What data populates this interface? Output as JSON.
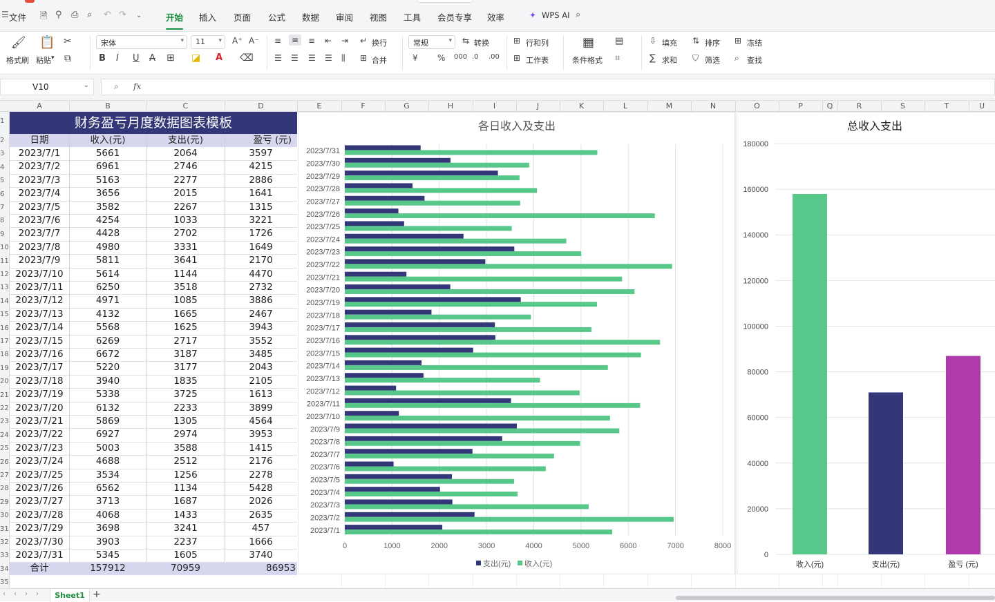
{
  "app": {
    "file_menu": "文件",
    "tabs": [
      "开始",
      "插入",
      "页面",
      "公式",
      "数据",
      "审阅",
      "视图",
      "工具",
      "会员专享",
      "效率"
    ],
    "active_tab": "开始",
    "wps_ai": "WPS AI",
    "accent": "#1e8e3e"
  },
  "ribbon": {
    "format_painter": "格式刷",
    "paste": "粘贴",
    "font_name": "宋体",
    "font_size": "11",
    "wrap": "换行",
    "merge": "合并",
    "number_format": "常规",
    "convert": "转换",
    "rows_cols": "行和列",
    "worksheet": "工作表",
    "conditional_format": "条件格式",
    "fill": "填充",
    "sort": "排序",
    "freeze": "冻结",
    "sum": "求和",
    "filter": "筛选",
    "find": "查找"
  },
  "formula_bar": {
    "name_box": "V10",
    "fx": "fx"
  },
  "columns": [
    "A",
    "B",
    "C",
    "D",
    "E",
    "F",
    "G",
    "H",
    "I",
    "J",
    "K",
    "L",
    "M",
    "N",
    "O",
    "P",
    "Q",
    "R",
    "S",
    "T",
    "U"
  ],
  "row_numbers": [
    "1",
    "2",
    "3",
    "4",
    "5",
    "6",
    "7",
    "8",
    "9",
    "10",
    "11",
    "12",
    "13",
    "14",
    "15",
    "16",
    "17",
    "18",
    "19",
    "20",
    "21",
    "22",
    "23",
    "24",
    "25",
    "26",
    "27",
    "28",
    "29",
    "30",
    "31",
    "32",
    "33",
    "34",
    "35"
  ],
  "table": {
    "title": "财务盈亏月度数据图表模板",
    "headers": [
      "日期",
      "收入(元)",
      "支出(元)",
      "盈亏 (元)"
    ],
    "rows": [
      [
        "2023/7/1",
        "5661",
        "2064",
        "3597"
      ],
      [
        "2023/7/2",
        "6961",
        "2746",
        "4215"
      ],
      [
        "2023/7/3",
        "5163",
        "2277",
        "2886"
      ],
      [
        "2023/7/4",
        "3656",
        "2015",
        "1641"
      ],
      [
        "2023/7/5",
        "3582",
        "2267",
        "1315"
      ],
      [
        "2023/7/6",
        "4254",
        "1033",
        "3221"
      ],
      [
        "2023/7/7",
        "4428",
        "2702",
        "1726"
      ],
      [
        "2023/7/8",
        "4980",
        "3331",
        "1649"
      ],
      [
        "2023/7/9",
        "5811",
        "3641",
        "2170"
      ],
      [
        "2023/7/10",
        "5614",
        "1144",
        "4470"
      ],
      [
        "2023/7/11",
        "6250",
        "3518",
        "2732"
      ],
      [
        "2023/7/12",
        "4971",
        "1085",
        "3886"
      ],
      [
        "2023/7/13",
        "4132",
        "1665",
        "2467"
      ],
      [
        "2023/7/14",
        "5568",
        "1625",
        "3943"
      ],
      [
        "2023/7/15",
        "6269",
        "2717",
        "3552"
      ],
      [
        "2023/7/16",
        "6672",
        "3187",
        "3485"
      ],
      [
        "2023/7/17",
        "5220",
        "3177",
        "2043"
      ],
      [
        "2023/7/18",
        "3940",
        "1835",
        "2105"
      ],
      [
        "2023/7/19",
        "5338",
        "3725",
        "1613"
      ],
      [
        "2023/7/20",
        "6132",
        "2233",
        "3899"
      ],
      [
        "2023/7/21",
        "5869",
        "1305",
        "4564"
      ],
      [
        "2023/7/22",
        "6927",
        "2974",
        "3953"
      ],
      [
        "2023/7/23",
        "5003",
        "3588",
        "1415"
      ],
      [
        "2023/7/24",
        "4688",
        "2512",
        "2176"
      ],
      [
        "2023/7/25",
        "3534",
        "1256",
        "2278"
      ],
      [
        "2023/7/26",
        "6562",
        "1134",
        "5428"
      ],
      [
        "2023/7/27",
        "3713",
        "1687",
        "2026"
      ],
      [
        "2023/7/28",
        "4068",
        "1433",
        "2635"
      ],
      [
        "2023/7/29",
        "3698",
        "3241",
        "457"
      ],
      [
        "2023/7/30",
        "3903",
        "2237",
        "1666"
      ],
      [
        "2023/7/31",
        "5345",
        "1605",
        "3740"
      ]
    ],
    "total": [
      "合计",
      "157912",
      "70959",
      "86953"
    ],
    "header_bg": "#333778",
    "band_bg": "#d6d7ef"
  },
  "chart_data": [
    {
      "type": "bar",
      "orientation": "horizontal",
      "title": "各日收入及支出",
      "categories": [
        "2023/7/1",
        "2023/7/2",
        "2023/7/3",
        "2023/7/4",
        "2023/7/5",
        "2023/7/6",
        "2023/7/7",
        "2023/7/8",
        "2023/7/9",
        "2023/7/10",
        "2023/7/11",
        "2023/7/12",
        "2023/7/13",
        "2023/7/14",
        "2023/7/15",
        "2023/7/16",
        "2023/7/17",
        "2023/7/18",
        "2023/7/19",
        "2023/7/20",
        "2023/7/21",
        "2023/7/22",
        "2023/7/23",
        "2023/7/24",
        "2023/7/25",
        "2023/7/26",
        "2023/7/27",
        "2023/7/28",
        "2023/7/29",
        "2023/7/30",
        "2023/7/31"
      ],
      "series": [
        {
          "name": "支出(元)",
          "color": "#333778",
          "values": [
            2064,
            2746,
            2277,
            2015,
            2267,
            1033,
            2702,
            3331,
            3641,
            1144,
            3518,
            1085,
            1665,
            1625,
            2717,
            3187,
            3177,
            1835,
            3725,
            2233,
            1305,
            2974,
            3588,
            2512,
            1256,
            1134,
            1687,
            1433,
            3241,
            2237,
            1605
          ]
        },
        {
          "name": "收入(元)",
          "color": "#57c78a",
          "values": [
            5661,
            6961,
            5163,
            3656,
            3582,
            4254,
            4428,
            4980,
            5811,
            5614,
            6250,
            4971,
            4132,
            5568,
            6269,
            6672,
            5220,
            3940,
            5338,
            6132,
            5869,
            6927,
            5003,
            4688,
            3534,
            6562,
            3713,
            4068,
            3698,
            3903,
            5345
          ]
        }
      ],
      "xlim": [
        0,
        8000
      ],
      "xticks": [
        "0",
        "1000",
        "2000",
        "3000",
        "4000",
        "5000",
        "6000",
        "7000",
        "8000"
      ],
      "grid": true,
      "legend": "bottom"
    },
    {
      "type": "bar",
      "title": "总收入支出",
      "categories": [
        "收入(元)",
        "支出(元)",
        "盈亏 (元)"
      ],
      "values": [
        157912,
        70959,
        86953
      ],
      "colors": [
        "#57c78a",
        "#333778",
        "#b03aac"
      ],
      "ylim": [
        0,
        180000
      ],
      "yticks": [
        "0",
        "20000",
        "40000",
        "60000",
        "80000",
        "100000",
        "120000",
        "140000",
        "160000",
        "180000"
      ],
      "grid": true
    }
  ],
  "sheet": {
    "tab": "Sheet1",
    "add": "+"
  }
}
